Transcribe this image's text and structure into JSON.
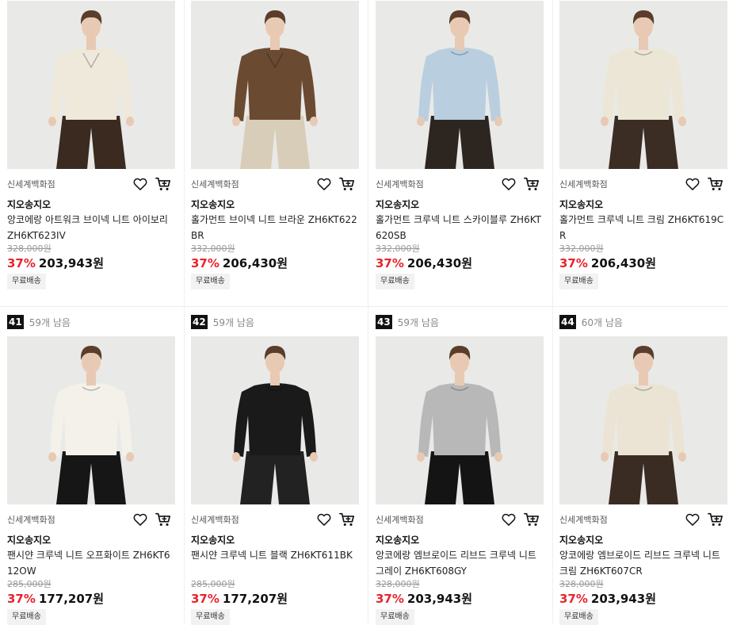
{
  "products": [
    {
      "rank": "",
      "remaining": "",
      "store": "신세계백화점",
      "brand": "지오송지오",
      "name": "앙코에랑 아트워크 브이넥 니트 아이보리 ZH6KT623IV",
      "original_price": "328,000원",
      "discount": "37%",
      "price": "203,943원",
      "shipping": "무료배송",
      "sweater": "#efe9dc",
      "pants": "#3a2a20",
      "neck": "v"
    },
    {
      "rank": "",
      "remaining": "",
      "store": "신세계백화점",
      "brand": "지오송지오",
      "name": "홀가먼트 브이넥 니트 브라운 ZH6KT622BR",
      "original_price": "332,000원",
      "discount": "37%",
      "price": "206,430원",
      "shipping": "무료배송",
      "sweater": "#6b4a32",
      "pants": "#d8cdb8",
      "neck": "v"
    },
    {
      "rank": "",
      "remaining": "",
      "store": "신세계백화점",
      "brand": "지오송지오",
      "name": "홀가먼트 크루넥 니트 스카이블루 ZH6KT620SB",
      "original_price": "332,000원",
      "discount": "37%",
      "price": "206,430원",
      "shipping": "무료배송",
      "sweater": "#b9cfdf",
      "pants": "#2d2620",
      "neck": "crew"
    },
    {
      "rank": "",
      "remaining": "",
      "store": "신세계백화점",
      "brand": "지오송지오",
      "name": "홀가먼트 크루넥 니트 크림 ZH6KT619CR",
      "original_price": "332,000원",
      "discount": "37%",
      "price": "206,430원",
      "shipping": "무료배송",
      "sweater": "#ece6d6",
      "pants": "#3b2d24",
      "neck": "crew"
    },
    {
      "rank": "41",
      "remaining": "59개 남음",
      "store": "신세계백화점",
      "brand": "지오송지오",
      "name": "팬시얀 크루넥 니트 오프화이트 ZH6KT612OW",
      "original_price": "285,000원",
      "discount": "37%",
      "price": "177,207원",
      "shipping": "무료배송",
      "sweater": "#f3f1ea",
      "pants": "#161616",
      "neck": "crew"
    },
    {
      "rank": "42",
      "remaining": "59개 남음",
      "store": "신세계백화점",
      "brand": "지오송지오",
      "name": "팬시얀 크루넥 니트 블랙 ZH6KT611BK",
      "original_price": "285,000원",
      "discount": "37%",
      "price": "177,207원",
      "shipping": "무료배송",
      "sweater": "#1a1a1a",
      "pants": "#222222",
      "neck": "crew"
    },
    {
      "rank": "43",
      "remaining": "59개 남음",
      "store": "신세계백화점",
      "brand": "지오송지오",
      "name": "앙코에랑 엠브로이드 리브드 크루넥 니트 그레이 ZH6KT608GY",
      "original_price": "328,000원",
      "discount": "37%",
      "price": "203,943원",
      "shipping": "무료배송",
      "sweater": "#b8b8b8",
      "pants": "#141414",
      "neck": "crew"
    },
    {
      "rank": "44",
      "remaining": "60개 남음",
      "store": "신세계백화점",
      "brand": "지오송지오",
      "name": "앙코에랑 엠브로이드 리브드 크루넥 니트 크림 ZH6KT607CR",
      "original_price": "328,000원",
      "discount": "37%",
      "price": "203,943원",
      "shipping": "무료배송",
      "sweater": "#ebe4d4",
      "pants": "#3a2c23",
      "neck": "crew"
    }
  ],
  "colors": {
    "discount": "#e8242c",
    "badge": "#111111",
    "photo_bg": "#e9e9e7",
    "skin": "#e8c9b3",
    "hair": "#5a3e2b"
  },
  "icons": {
    "wishlist": "heart-icon",
    "cart": "cart-icon"
  }
}
